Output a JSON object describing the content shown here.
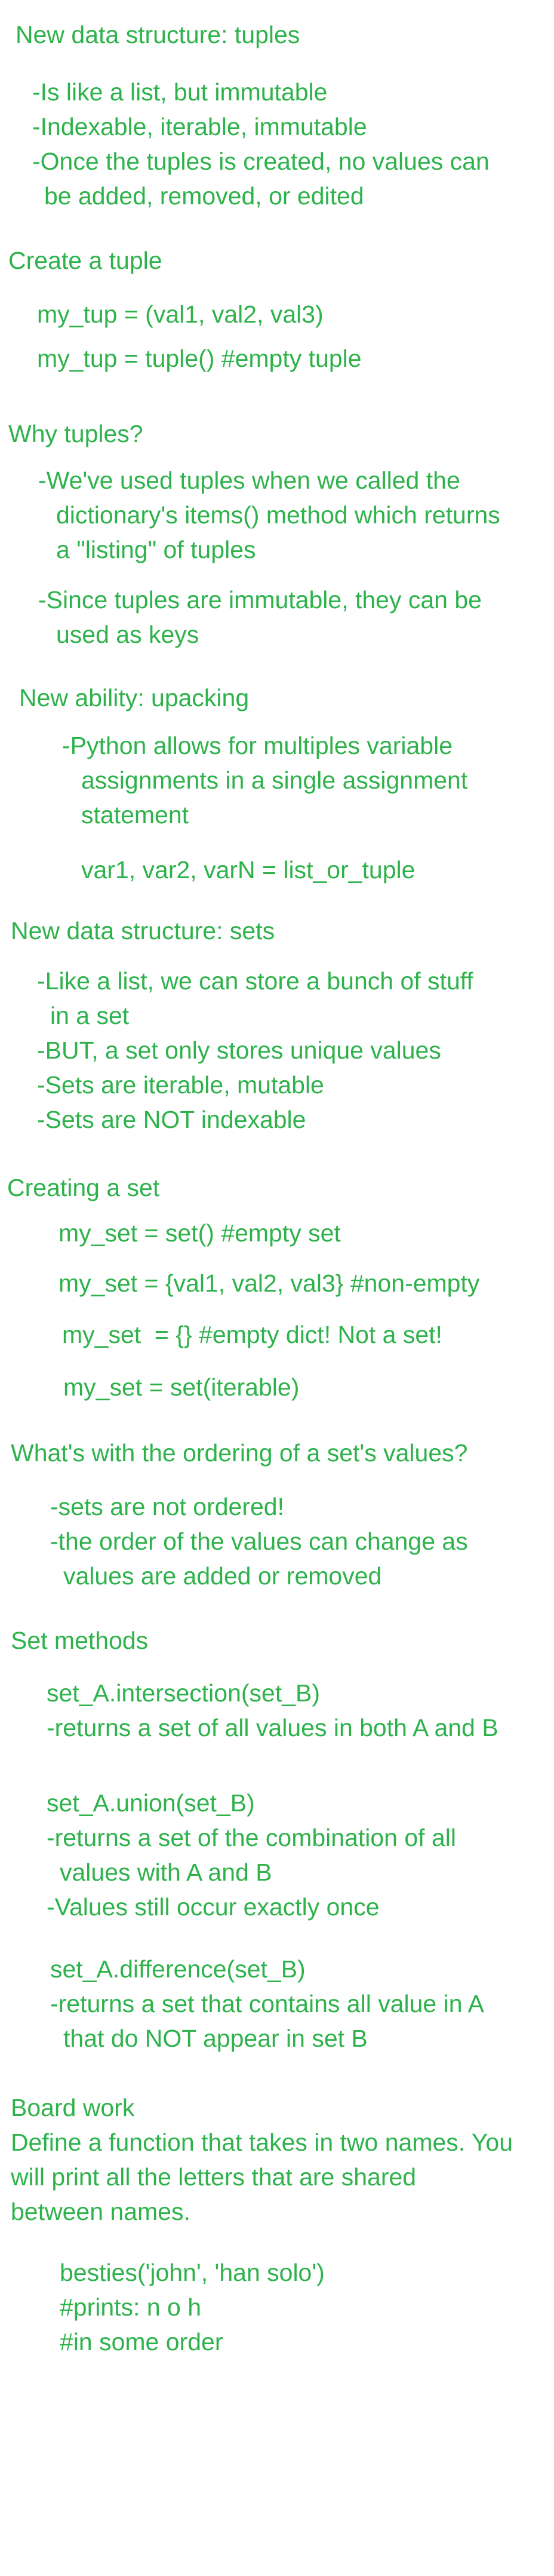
{
  "text_color": "#2eb24b",
  "background_color": "#ffffff",
  "lines": [
    "New data structure: tuples",
    "-Is like a list, but immutable",
    "-Indexable, iterable, immutable",
    "-Once the tuples is created, no values can",
    "be added, removed, or edited",
    "Create a tuple",
    "my_tup = (val1, val2, val3)",
    "my_tup = tuple() #empty tuple",
    "Why tuples?",
    "-We've used tuples when we called the",
    "dictionary's items() method which returns",
    "a \"listing\" of tuples",
    "-Since tuples are immutable, they can be",
    "used as keys",
    "New ability: upacking",
    "-Python allows for multiples variable",
    "assignments in a single assignment",
    "statement",
    "var1, var2, varN = list_or_tuple",
    "New data structure: sets",
    "-Like a list, we can store a bunch of stuff",
    "in a set",
    "-BUT, a set only stores unique values",
    "-Sets are iterable, mutable",
    "-Sets are NOT indexable",
    "Creating a set",
    "my_set = set() #empty set",
    "my_set = {val1, val2, val3} #non-empty",
    "my_set  = {} #empty dict! Not a set!",
    "my_set = set(iterable)",
    "What's with the ordering of a set's values?",
    "-sets are not ordered!",
    "-the order of the values can change as",
    "values are added or removed",
    "Set methods",
    "set_A.intersection(set_B)",
    "-returns a set of all values in both A and B",
    "set_A.union(set_B)",
    "-returns a set of the combination of all",
    "values with A and B",
    "-Values still occur exactly once",
    "set_A.difference(set_B)",
    "-returns a set that contains all value in A",
    "that do NOT appear in set B",
    "Board work",
    "Define a function that takes in two names. You",
    "will print all the letters that are shared",
    "between names.",
    "besties('john', 'han solo')",
    "#prints: n o h",
    "#in some order"
  ]
}
